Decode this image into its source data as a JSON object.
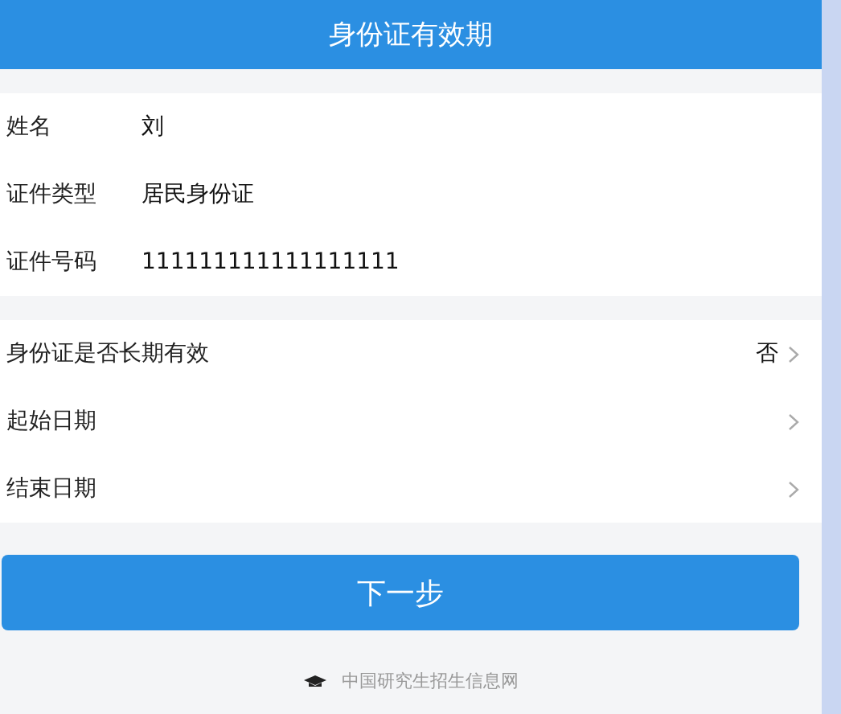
{
  "header": {
    "title": "身份证有效期"
  },
  "info": [
    {
      "label": "姓名",
      "value": "刘"
    },
    {
      "label": "证件类型",
      "value": "居民身份证"
    },
    {
      "label": "证件号码",
      "value": "111111111111111111"
    }
  ],
  "options": [
    {
      "label": "身份证是否长期有效",
      "value": "否"
    },
    {
      "label": "起始日期"
    },
    {
      "label": "结束日期"
    }
  ],
  "next_button": "下一步",
  "footer": {
    "text": "中国研究生招生信息网"
  }
}
